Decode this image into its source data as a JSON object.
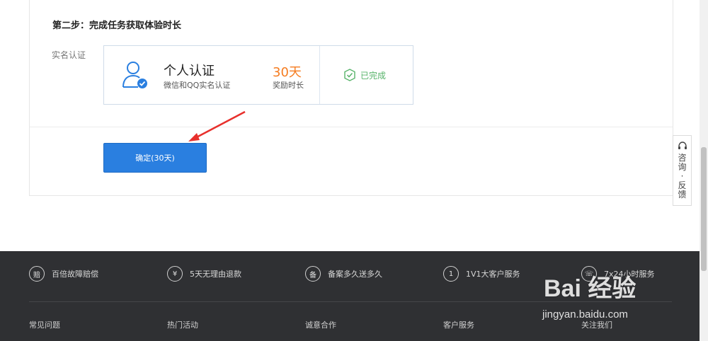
{
  "step": {
    "title": "第二步：完成任务获取体验时长"
  },
  "row": {
    "label": "实名认证"
  },
  "task": {
    "icon": "user-verified-icon",
    "name": "个人认证",
    "desc": "微信和QQ实名认证",
    "reward_days": "30天",
    "reward_label": "奖励时长",
    "status_icon": "check-shield-icon",
    "status": "已完成"
  },
  "confirm": {
    "label": "确定(30天)"
  },
  "side_widget": {
    "icon": "headset-icon",
    "text": "咨询·反馈"
  },
  "footer": {
    "features": [
      {
        "icon_char": "赔",
        "label": "百倍故障赔偿"
      },
      {
        "icon_char": "¥",
        "label": "5天无理由退款"
      },
      {
        "icon_char": "备",
        "label": "备案多久送多久"
      },
      {
        "icon_char": "1",
        "label": "1V1大客户服务"
      },
      {
        "icon_char": "☏",
        "label": "7x24小时服务"
      }
    ],
    "columns": [
      "常见问题",
      "热门活动",
      "诚意合作",
      "客户服务",
      "关注我们"
    ]
  },
  "watermark": {
    "brand": "Bai 经验",
    "url": "jingyan.baidu.com"
  },
  "colors": {
    "accent": "#2a7fe0",
    "reward": "#f57c20",
    "success": "#57b36a",
    "footer_bg": "#2f3033"
  }
}
